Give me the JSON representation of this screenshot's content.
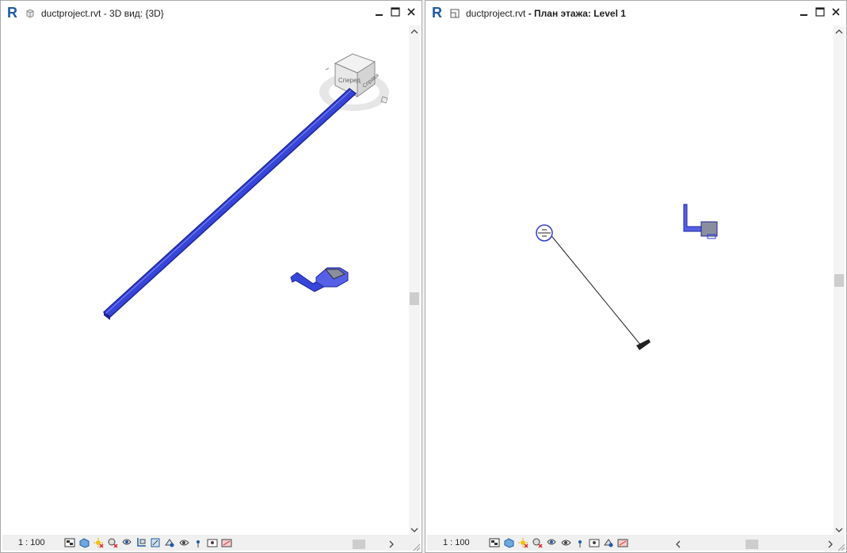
{
  "left_window": {
    "title_file": "ductproject.rvt",
    "title_view": " - 3D вид: {3D}",
    "scale": "1 : 100"
  },
  "right_window": {
    "title_file": "ductproject.rvt",
    "title_view": " - План этажа: Level 1",
    "scale": "1 : 100"
  },
  "viewcube": {
    "front_label": "Сперед",
    "side_label": "Справа"
  },
  "view_control_tools": [
    "detail-level-icon",
    "visual-style-icon",
    "sun-path-icon",
    "shadows-icon",
    "crop-view-icon",
    "show-crop-icon",
    "temporary-hide-icon",
    "reveal-hidden-icon",
    "temporary-view-properties-icon",
    "highlight-displacement-icon",
    "analytical-model-icon",
    "constraints-icon"
  ],
  "colors": {
    "duct": "#2f3dd4",
    "duct_dark": "#1c2699",
    "revit_blue": "#1f5aa6"
  }
}
